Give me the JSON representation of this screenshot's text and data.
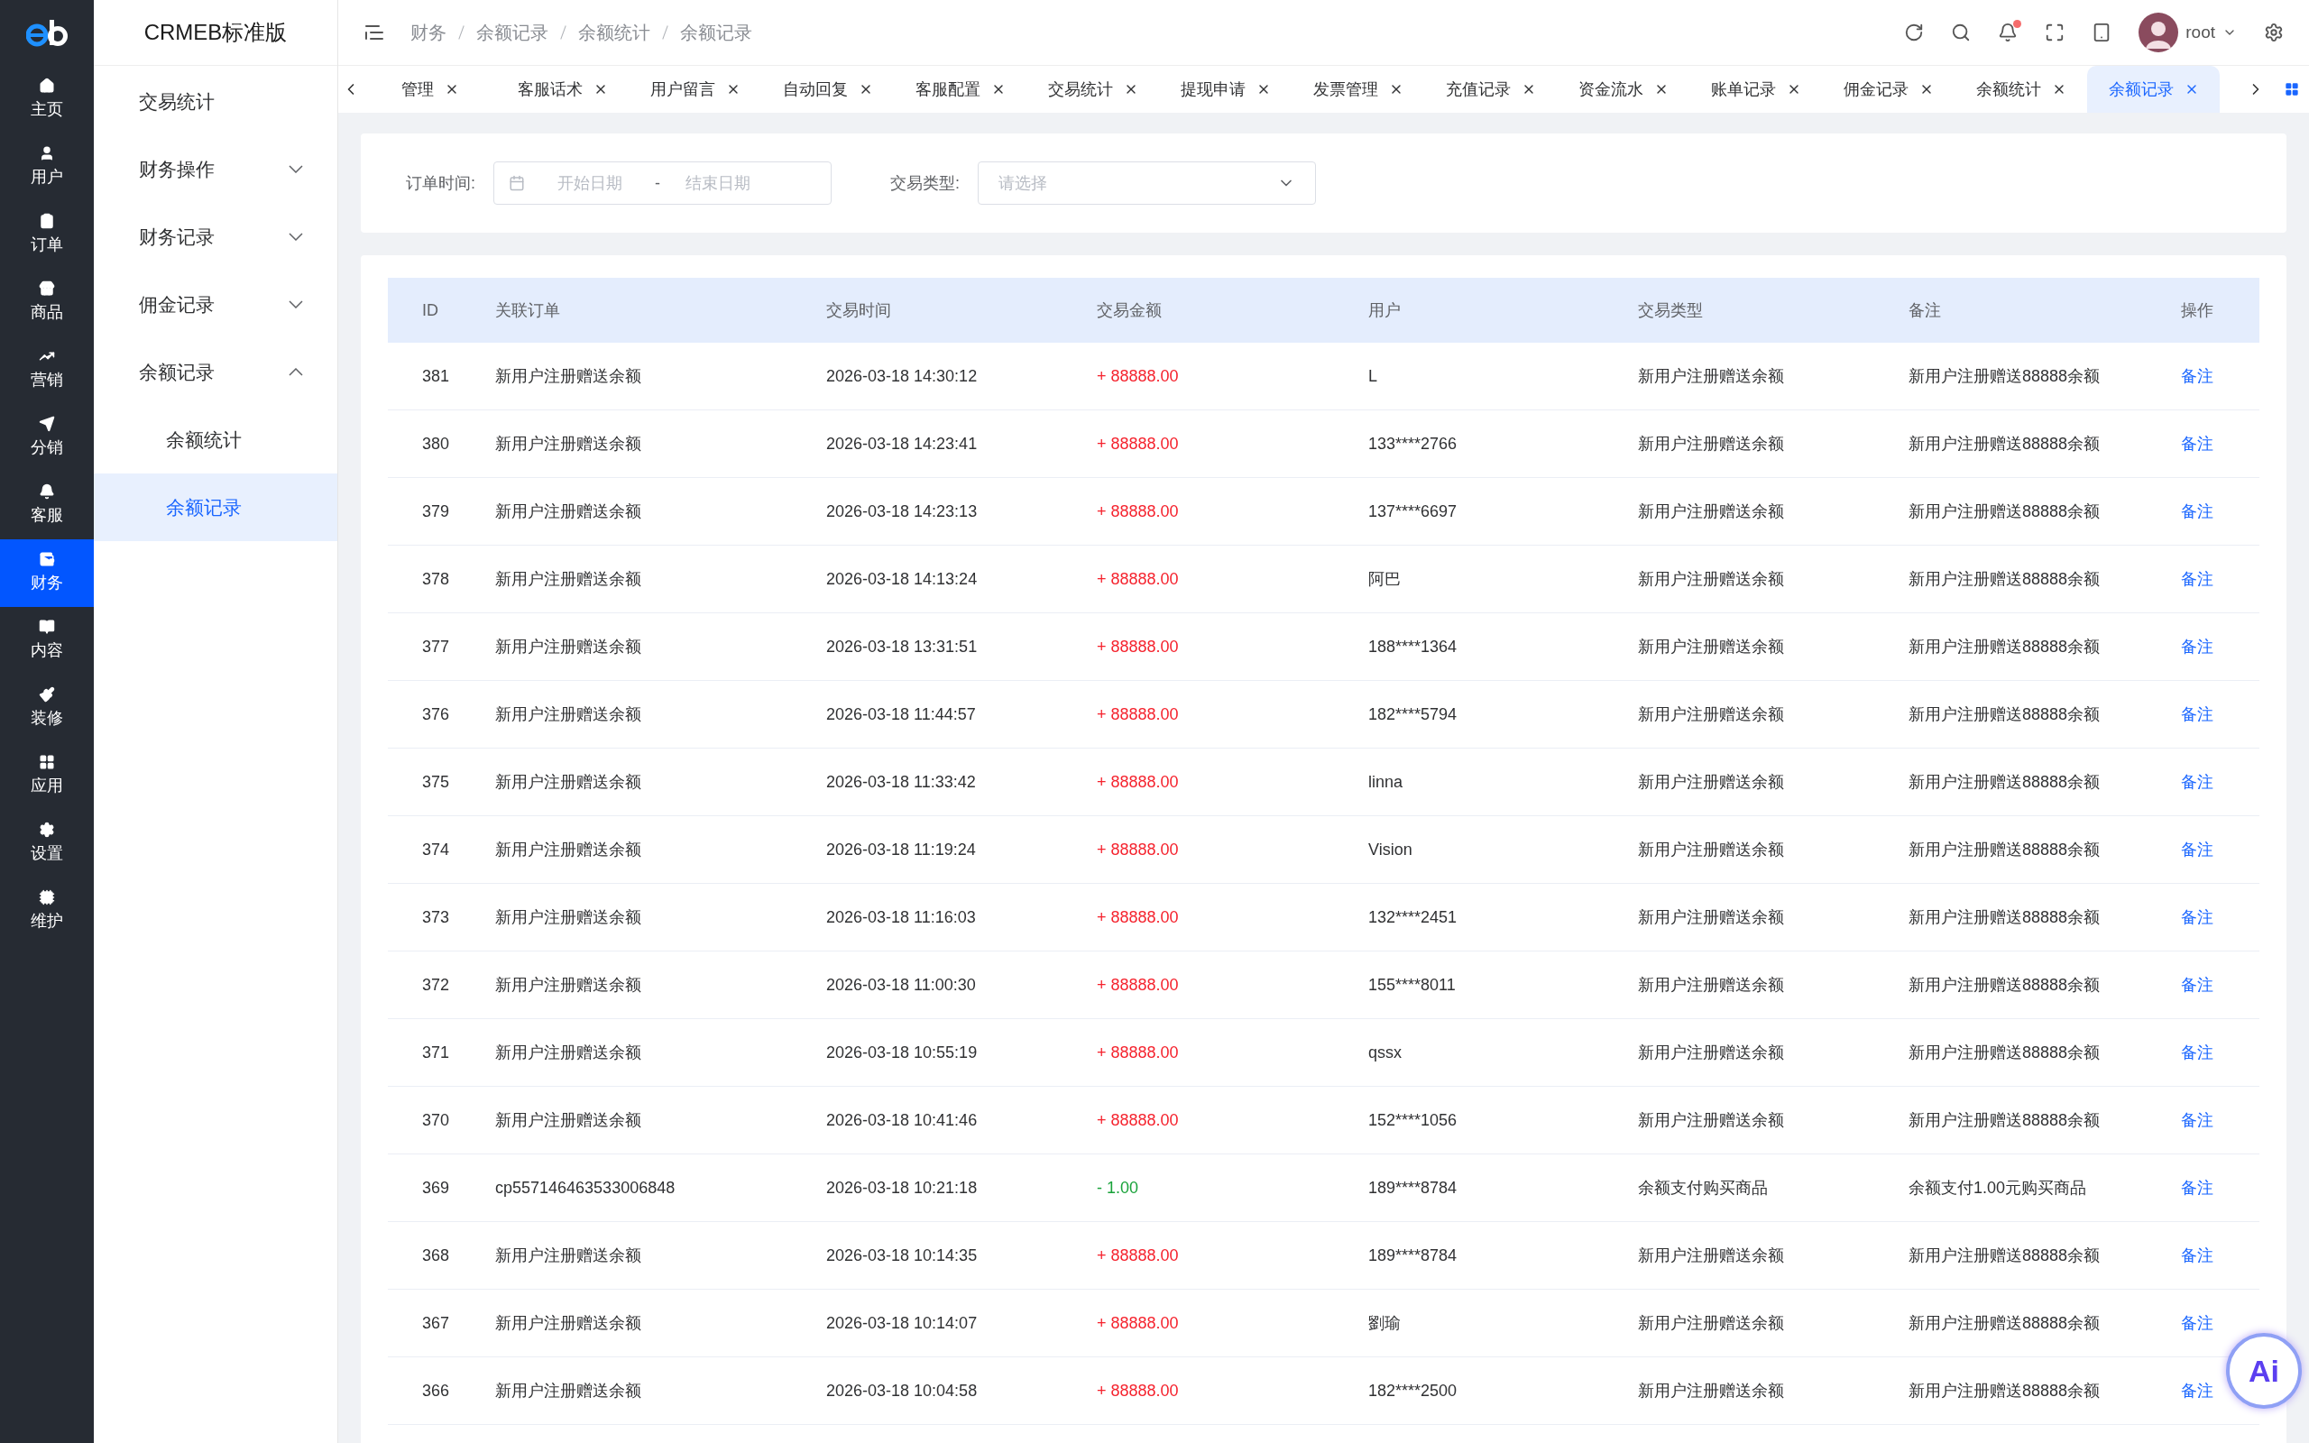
{
  "app": {
    "title": "CRMEB标准版"
  },
  "main_nav": [
    {
      "label": "主页",
      "selected": false
    },
    {
      "label": "用户",
      "selected": false
    },
    {
      "label": "订单",
      "selected": false
    },
    {
      "label": "商品",
      "selected": false
    },
    {
      "label": "营销",
      "selected": false
    },
    {
      "label": "分销",
      "selected": false
    },
    {
      "label": "客服",
      "selected": false
    },
    {
      "label": "财务",
      "selected": true
    },
    {
      "label": "内容",
      "selected": false
    },
    {
      "label": "装修",
      "selected": false
    },
    {
      "label": "应用",
      "selected": false
    },
    {
      "label": "设置",
      "selected": false
    },
    {
      "label": "维护",
      "selected": false
    }
  ],
  "sub_nav": [
    {
      "label": "交易统计",
      "kind": "link",
      "selected": false
    },
    {
      "label": "财务操作",
      "kind": "group",
      "expanded": false,
      "selected": false
    },
    {
      "label": "财务记录",
      "kind": "group",
      "expanded": false,
      "selected": false
    },
    {
      "label": "佣金记录",
      "kind": "group",
      "expanded": false,
      "selected": false
    },
    {
      "label": "余额记录",
      "kind": "group",
      "expanded": true,
      "selected": false,
      "children": [
        {
          "label": "余额统计",
          "kind": "link",
          "selected": false
        },
        {
          "label": "余额记录",
          "kind": "link",
          "selected": true
        }
      ]
    }
  ],
  "breadcrumb": [
    "财务",
    "余额记录",
    "余额统计",
    "余额记录"
  ],
  "header": {
    "user": "root",
    "has_notification": true
  },
  "tabs": [
    {
      "label": "管理",
      "selected": false
    },
    {
      "label": "客服话术",
      "selected": false
    },
    {
      "label": "用户留言",
      "selected": false
    },
    {
      "label": "自动回复",
      "selected": false
    },
    {
      "label": "客服配置",
      "selected": false
    },
    {
      "label": "交易统计",
      "selected": false
    },
    {
      "label": "提现申请",
      "selected": false
    },
    {
      "label": "发票管理",
      "selected": false
    },
    {
      "label": "充值记录",
      "selected": false
    },
    {
      "label": "资金流水",
      "selected": false
    },
    {
      "label": "账单记录",
      "selected": false
    },
    {
      "label": "佣金记录",
      "selected": false
    },
    {
      "label": "余额统计",
      "selected": false
    },
    {
      "label": "余额记录",
      "selected": true
    }
  ],
  "filters": {
    "date_label": "订单时间:",
    "start_placeholder": "开始日期",
    "range_separator": "-",
    "end_placeholder": "结束日期",
    "type_label": "交易类型:",
    "type_placeholder": "请选择"
  },
  "table": {
    "columns": [
      "ID",
      "关联订单",
      "交易时间",
      "交易金额",
      "用户",
      "交易类型",
      "备注",
      "操作"
    ],
    "rows": [
      {
        "id": "381",
        "order": "新用户注册赠送余额",
        "time": "2026-03-18 14:30:12",
        "amount": "+ 88888.00",
        "kind": "income",
        "user": "L",
        "type": "新用户注册赠送余额",
        "note": "新用户注册赠送88888余额",
        "action": "备注"
      },
      {
        "id": "380",
        "order": "新用户注册赠送余额",
        "time": "2026-03-18 14:23:41",
        "amount": "+ 88888.00",
        "kind": "income",
        "user": "133****2766",
        "type": "新用户注册赠送余额",
        "note": "新用户注册赠送88888余额",
        "action": "备注"
      },
      {
        "id": "379",
        "order": "新用户注册赠送余额",
        "time": "2026-03-18 14:23:13",
        "amount": "+ 88888.00",
        "kind": "income",
        "user": "137****6697",
        "type": "新用户注册赠送余额",
        "note": "新用户注册赠送88888余额",
        "action": "备注"
      },
      {
        "id": "378",
        "order": "新用户注册赠送余额",
        "time": "2026-03-18 14:13:24",
        "amount": "+ 88888.00",
        "kind": "income",
        "user": "阿巴",
        "type": "新用户注册赠送余额",
        "note": "新用户注册赠送88888余额",
        "action": "备注"
      },
      {
        "id": "377",
        "order": "新用户注册赠送余额",
        "time": "2026-03-18 13:31:51",
        "amount": "+ 88888.00",
        "kind": "income",
        "user": "188****1364",
        "type": "新用户注册赠送余额",
        "note": "新用户注册赠送88888余额",
        "action": "备注"
      },
      {
        "id": "376",
        "order": "新用户注册赠送余额",
        "time": "2026-03-18 11:44:57",
        "amount": "+ 88888.00",
        "kind": "income",
        "user": "182****5794",
        "type": "新用户注册赠送余额",
        "note": "新用户注册赠送88888余额",
        "action": "备注"
      },
      {
        "id": "375",
        "order": "新用户注册赠送余额",
        "time": "2026-03-18 11:33:42",
        "amount": "+ 88888.00",
        "kind": "income",
        "user": "linna",
        "type": "新用户注册赠送余额",
        "note": "新用户注册赠送88888余额",
        "action": "备注"
      },
      {
        "id": "374",
        "order": "新用户注册赠送余额",
        "time": "2026-03-18 11:19:24",
        "amount": "+ 88888.00",
        "kind": "income",
        "user": "Vision",
        "type": "新用户注册赠送余额",
        "note": "新用户注册赠送88888余额",
        "action": "备注"
      },
      {
        "id": "373",
        "order": "新用户注册赠送余额",
        "time": "2026-03-18 11:16:03",
        "amount": "+ 88888.00",
        "kind": "income",
        "user": "132****2451",
        "type": "新用户注册赠送余额",
        "note": "新用户注册赠送88888余额",
        "action": "备注"
      },
      {
        "id": "372",
        "order": "新用户注册赠送余额",
        "time": "2026-03-18 11:00:30",
        "amount": "+ 88888.00",
        "kind": "income",
        "user": "155****8011",
        "type": "新用户注册赠送余额",
        "note": "新用户注册赠送88888余额",
        "action": "备注"
      },
      {
        "id": "371",
        "order": "新用户注册赠送余额",
        "time": "2026-03-18 10:55:19",
        "amount": "+ 88888.00",
        "kind": "income",
        "user": "qssx",
        "type": "新用户注册赠送余额",
        "note": "新用户注册赠送88888余额",
        "action": "备注"
      },
      {
        "id": "370",
        "order": "新用户注册赠送余额",
        "time": "2026-03-18 10:41:46",
        "amount": "+ 88888.00",
        "kind": "income",
        "user": "152****1056",
        "type": "新用户注册赠送余额",
        "note": "新用户注册赠送88888余额",
        "action": "备注"
      },
      {
        "id": "369",
        "order": "cp557146463533006848",
        "time": "2026-03-18 10:21:18",
        "amount": "- 1.00",
        "kind": "expense",
        "user": "189****8784",
        "type": "余额支付购买商品",
        "note": "余额支付1.00元购买商品",
        "action": "备注"
      },
      {
        "id": "368",
        "order": "新用户注册赠送余额",
        "time": "2026-03-18 10:14:35",
        "amount": "+ 88888.00",
        "kind": "income",
        "user": "189****8784",
        "type": "新用户注册赠送余额",
        "note": "新用户注册赠送88888余额",
        "action": "备注"
      },
      {
        "id": "367",
        "order": "新用户注册赠送余额",
        "time": "2026-03-18 10:14:07",
        "amount": "+ 88888.00",
        "kind": "income",
        "user": "劉瑜",
        "type": "新用户注册赠送余额",
        "note": "新用户注册赠送88888余额",
        "action": "备注"
      },
      {
        "id": "366",
        "order": "新用户注册赠送余额",
        "time": "2026-03-18 10:04:58",
        "amount": "+ 88888.00",
        "kind": "income",
        "user": "182****2500",
        "type": "新用户注册赠送余额",
        "note": "新用户注册赠送88888余额",
        "action": "备注"
      }
    ]
  },
  "ai_button": {
    "label": "Ai"
  }
}
